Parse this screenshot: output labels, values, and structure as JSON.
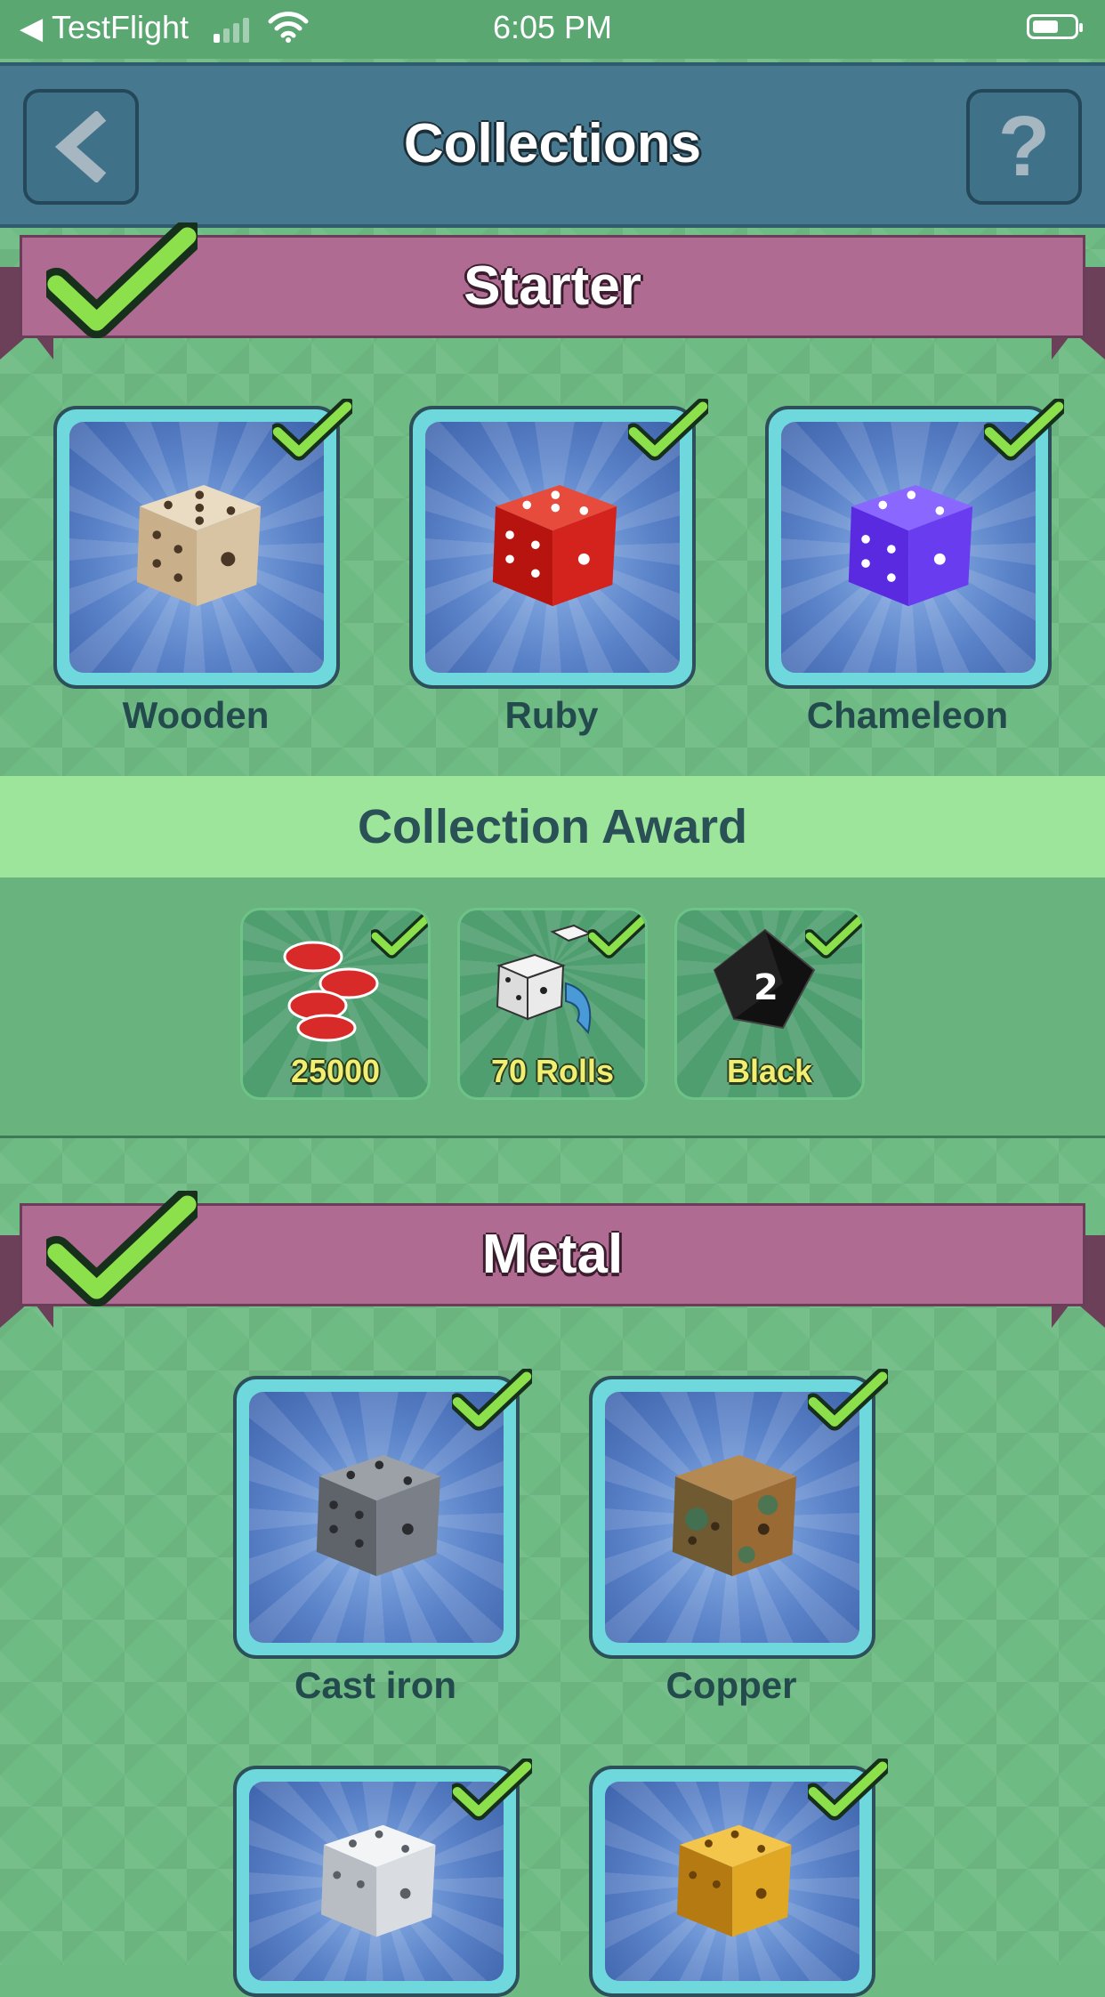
{
  "status_bar": {
    "back_app": "TestFlight",
    "time": "6:05 PM"
  },
  "header": {
    "title": "Collections"
  },
  "sections": [
    {
      "title": "Starter",
      "completed": true,
      "dice": [
        {
          "name": "Wooden",
          "color": "#d8c4a2",
          "owned": true
        },
        {
          "name": "Ruby",
          "color": "#d3231c",
          "owned": true
        },
        {
          "name": "Chameleon",
          "color": "#6a3cf0",
          "owned": true
        }
      ]
    },
    {
      "title": "Metal",
      "completed": true,
      "dice": [
        {
          "name": "Cast iron",
          "color": "#7b8088",
          "owned": true
        },
        {
          "name": "Copper",
          "color": "#9a6a34",
          "owned": true
        },
        {
          "name": "",
          "color": "#d9dde2",
          "owned": true
        },
        {
          "name": "",
          "color": "#e0a724",
          "owned": true
        }
      ]
    }
  ],
  "collection_award": {
    "title": "Collection Award",
    "items": [
      {
        "label": "25000",
        "icon": "chips-icon",
        "claimed": true
      },
      {
        "label": "70 Rolls",
        "icon": "dice-roll-icon",
        "claimed": true
      },
      {
        "label": "Black",
        "icon": "black-die-icon",
        "claimed": true
      }
    ]
  },
  "colors": {
    "background": "#6fbb84",
    "header": "#46798f",
    "banner": "#b06b92",
    "check": "#8be04c"
  }
}
